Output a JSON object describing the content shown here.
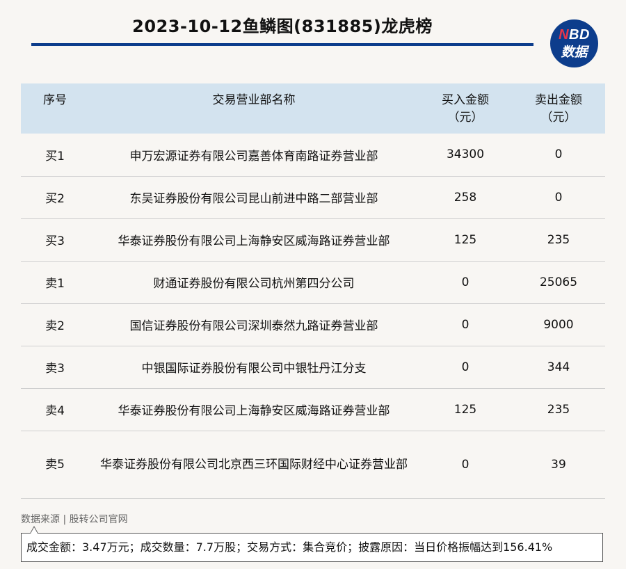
{
  "header": {
    "title": "2023-10-12鱼鳞图(831885)龙虎榜",
    "logo_top_n": "N",
    "logo_top_rest": "BD",
    "logo_bottom": "数据"
  },
  "table": {
    "columns": {
      "index": "序号",
      "branch": "交易营业部名称",
      "buy_line1": "买入金额",
      "buy_line2": "（元）",
      "sell_line1": "卖出金额",
      "sell_line2": "（元）"
    },
    "rows": [
      {
        "index": "买1",
        "branch": "申万宏源证券有限公司嘉善体育南路证券营业部",
        "buy": "34300",
        "sell": "0"
      },
      {
        "index": "买2",
        "branch": "东吴证券股份有限公司昆山前进中路二部营业部",
        "buy": "258",
        "sell": "0"
      },
      {
        "index": "买3",
        "branch": "华泰证券股份有限公司上海静安区威海路证券营业部",
        "buy": "125",
        "sell": "235"
      },
      {
        "index": "卖1",
        "branch": "财通证券股份有限公司杭州第四分公司",
        "buy": "0",
        "sell": "25065"
      },
      {
        "index": "卖2",
        "branch": "国信证券股份有限公司深圳泰然九路证券营业部",
        "buy": "0",
        "sell": "9000"
      },
      {
        "index": "卖3",
        "branch": "中银国际证券股份有限公司中银牡丹江分支",
        "buy": "0",
        "sell": "344"
      },
      {
        "index": "卖4",
        "branch": "华泰证券股份有限公司上海静安区威海路证券营业部",
        "buy": "125",
        "sell": "235"
      },
      {
        "index": "卖5",
        "branch": "华泰证券股份有限公司北京西三环国际财经中心证券营业部",
        "buy": "0",
        "sell": "39"
      }
    ]
  },
  "footer": {
    "source": "数据来源 | 股转公司官网",
    "note": "成交金额：3.47万元；成交数量：7.7万股；交易方式：集合竞价；披露原因：当日价格振幅达到156.41%"
  },
  "colors": {
    "accent": "#0d3d8c",
    "header_bg": "#d3e3ef",
    "logo_red": "#e8364a"
  }
}
